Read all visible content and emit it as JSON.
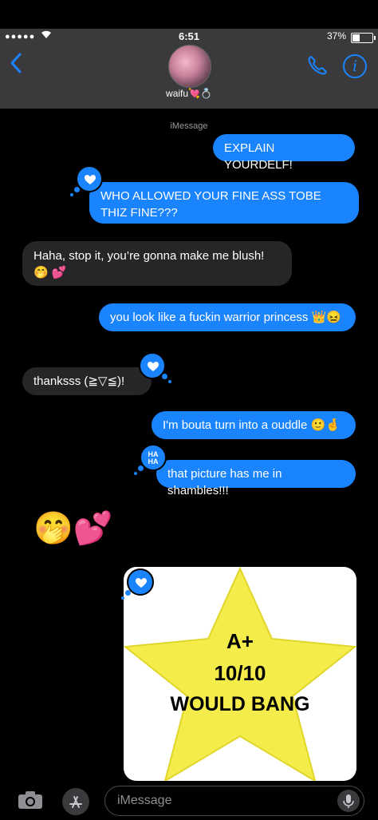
{
  "status_bar": {
    "signal": "●●●●●",
    "time": "6:51",
    "battery": "37%"
  },
  "header": {
    "contact_name": "waifu💘💍"
  },
  "thread": {
    "service_label": "iMessage",
    "messages": [
      {
        "text": "EXPLAIN YOURDELF!"
      },
      {
        "text": "WHO ALLOWED YOUR FINE ASS TOBE THIZ FINE???"
      },
      {
        "text": "Haha, stop it, you’re gonna make me blush! 🤭 💕"
      },
      {
        "text": "you look like a fuckin warrior princess 👑😖"
      },
      {
        "text": "thanksss (≧▽≦)!"
      },
      {
        "text": "I'm bouta turn into a ouddle 🙂🤞"
      },
      {
        "text": "that picture has me in shambles!!!"
      },
      {
        "text": "🤭💕"
      }
    ],
    "tapbacks": {
      "haha_line1": "HA",
      "haha_line2": "HA"
    },
    "photo": {
      "line1": "A+",
      "line2": "10/10",
      "line3": "WOULD BANG"
    }
  },
  "composer": {
    "placeholder": "iMessage"
  },
  "colors": {
    "accent_blue": "#1a84ff",
    "incoming_bubble": "#262629",
    "header_bg": "#3a3a3c",
    "star_yellow": "#f4ec4a"
  },
  "icons": [
    "back-chevron-icon",
    "phone-icon",
    "info-icon",
    "heart-icon",
    "camera-icon",
    "app-store-icon",
    "microphone-icon"
  ]
}
